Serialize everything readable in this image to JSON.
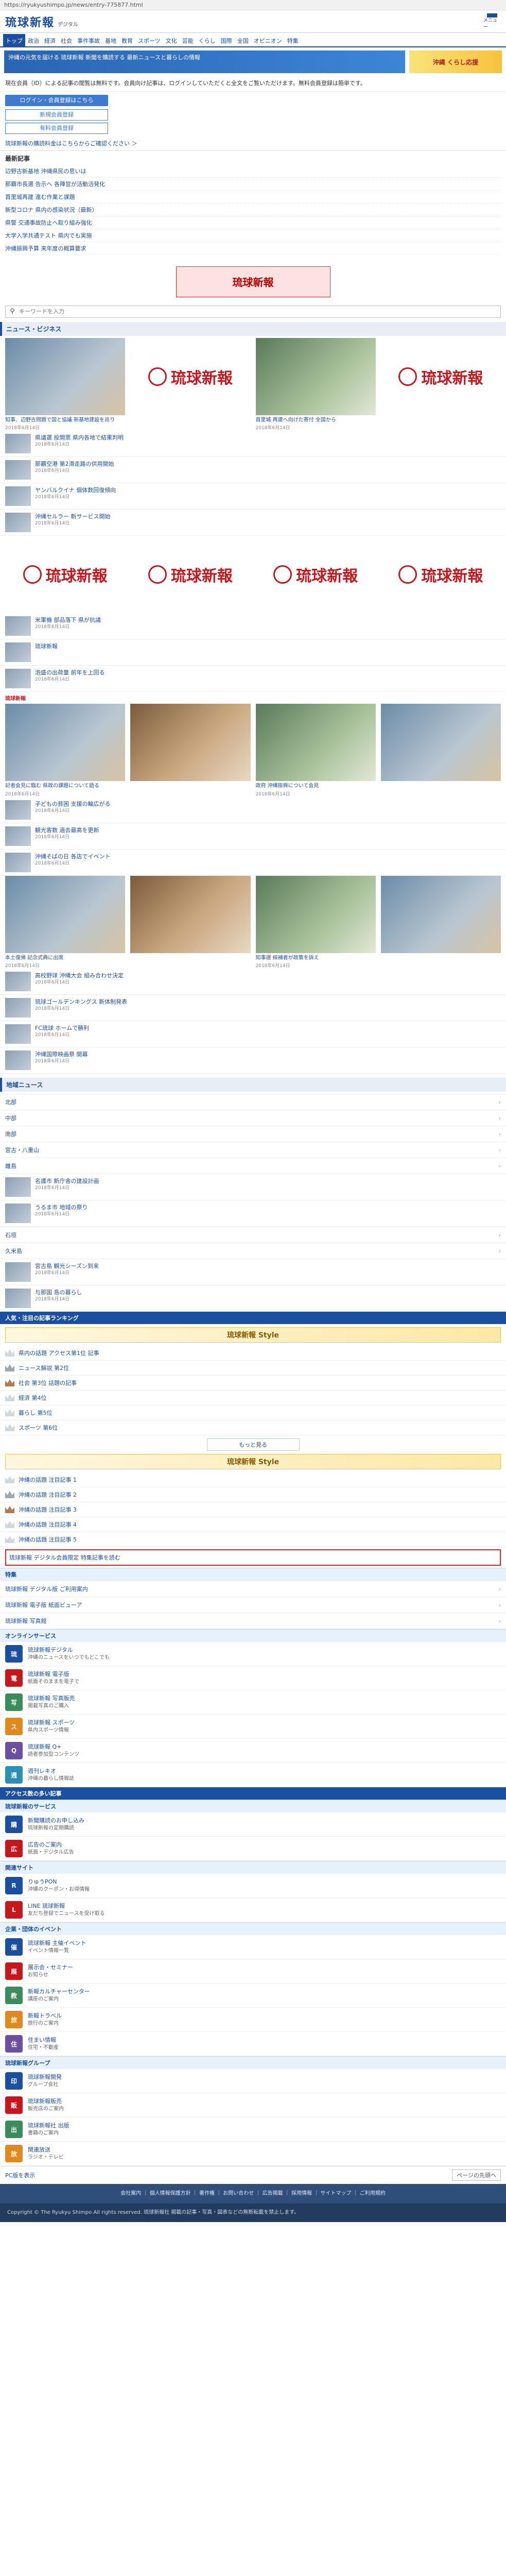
{
  "browser": {
    "url": "https://ryukyushimpo.jp/news/entry-775877.html"
  },
  "header": {
    "logo": "琉球新報",
    "logo_sub": "デジタル",
    "menu_label": "メニュー"
  },
  "gnav": [
    "トップ",
    "政治",
    "経済",
    "社会",
    "事件事故",
    "基地",
    "教育",
    "スポーツ",
    "文化",
    "芸能",
    "くらし",
    "国際",
    "全国",
    "オピニオン",
    "特集"
  ],
  "top_banner": {
    "promo_text": "沖縄の元気を届ける 琉球新報 新聞を購読する 最新ニュースと暮らしの情報",
    "ad_text": "沖縄 くらし応援"
  },
  "notice": "現在会員（ID）による記事の閲覧は無料です。会員向け記事は、ログインしていただくと全文をご覧いただけます。無料会員登録は簡単です。",
  "buttons": {
    "login": "ログイン・会員登録はこちら",
    "register": "新規会員登録",
    "paid": "有料会員登録"
  },
  "note_link": "琉球新報の購読料金はこちらからご確認ください ＞",
  "newslist": {
    "head": "最新記事",
    "items": [
      "辺野古新基地 沖縄県民の思いは",
      "那覇市長選 告示へ 各陣営が活動活発化",
      "首里城再建 進む作業と課題",
      "新型コロナ 県内の感染状況（最新）",
      "県警 交通事故防止へ取り組み強化",
      "大学入学共通テスト 県内でも実施",
      "沖縄振興予算 来年度の概算要求"
    ]
  },
  "ad_large": "琉球新報",
  "search": {
    "placeholder": "キーワードを入力"
  },
  "sec_biz": "ニュース・ビジネス",
  "cards1": [
    {
      "cap": "知事、辺野古問題で国と協議 新基地建設を巡り",
      "date": "2018年6月14日"
    },
    {
      "cap": "琉球新報",
      "date": ""
    },
    {
      "cap": "首里城 再建へ向けた寄付 全国から",
      "date": "2018年6月14日"
    },
    {
      "cap": "琉球新報",
      "date": ""
    }
  ],
  "rows1": [
    {
      "text": "県議選 投開票 県内各地で結果判明",
      "date": "2018年6月14日"
    },
    {
      "text": "那覇空港 第2滑走路の供用開始",
      "date": "2018年6月14日"
    },
    {
      "text": "ヤンバルクイナ 個体数回復傾向",
      "date": "2018年6月14日"
    },
    {
      "text": "沖縄セルラー 新サービス開始",
      "date": "2018年6月14日"
    }
  ],
  "cards2": [
    {
      "cap": "琉球新報",
      "date": ""
    },
    {
      "cap": "琉球新報",
      "date": ""
    },
    {
      "cap": "琉球新報",
      "date": ""
    },
    {
      "cap": "琉球新報",
      "date": ""
    }
  ],
  "cards2_caps": [
    "うりずんの季節 観光客でにぎわう",
    "",
    "県議会",
    ""
  ],
  "rows2": [
    {
      "text": "米軍機 部品落下 県が抗議",
      "date": "2018年6月14日"
    },
    {
      "text": "琉球新報",
      "date": ""
    },
    {
      "text": "泡盛の出荷量 前年を上回る",
      "date": "2018年6月14日"
    }
  ],
  "brand_mini": "琉球新報",
  "cards3": [
    {
      "cap": "記者会見に臨む 県政の課題について語る",
      "date": "2018年6月14日"
    },
    {
      "cap": "",
      "date": ""
    },
    {
      "cap": "政府 沖縄振興について会見",
      "date": "2018年6月14日"
    },
    {
      "cap": "",
      "date": ""
    }
  ],
  "rows3": [
    {
      "text": "子どもの貧困 支援の輪広がる",
      "date": "2018年6月14日"
    },
    {
      "text": "観光客数 過去最高を更新",
      "date": "2018年6月14日"
    },
    {
      "text": "沖縄そばの日 各店でイベント",
      "date": "2018年6月14日"
    }
  ],
  "cards4": [
    {
      "cap": "本土復帰 記念式典に出席",
      "date": "2018年6月14日"
    },
    {
      "cap": "",
      "date": ""
    },
    {
      "cap": "知事選 候補者が政策を訴え",
      "date": "2018年6月14日"
    },
    {
      "cap": "",
      "date": ""
    }
  ],
  "rows4": [
    {
      "text": "高校野球 沖縄大会 組み合わせ決定",
      "date": "2018年6月14日"
    },
    {
      "text": "琉球ゴールデンキングス 新体制発表",
      "date": "2018年6月14日"
    },
    {
      "text": "FC琉球 ホームで勝利",
      "date": "2018年6月14日"
    },
    {
      "text": "沖縄国際映画祭 開幕",
      "date": "2018年6月14日"
    }
  ],
  "sec_region": "地域ニュース",
  "region_items": [
    "北部",
    "中部",
    "南部",
    "宮古・八重山",
    "離島"
  ],
  "region_rows": [
    {
      "text": "名護市 新庁舎の建設計画",
      "date": "2018年6月14日"
    },
    {
      "text": "うるま市 地域の祭り",
      "date": "2018年6月14日"
    }
  ],
  "region_items2": [
    "石垣",
    "久米島"
  ],
  "region_rows2": [
    {
      "text": "宮古島 観光シーズン到来",
      "date": "2018年6月14日"
    },
    {
      "text": "与那国 島の暮らし",
      "date": "2018年6月14日"
    }
  ],
  "rank_title": "人気・注目の記事ランキング",
  "mid_banner": "琉球新報 Style",
  "rank_items": [
    "県内の話題 アクセス第1位 記事",
    "ニュース解説 第2位",
    "社会 第3位 話題の記事",
    "経済 第4位",
    "暮らし 第5位",
    "スポーツ 第6位"
  ],
  "more_label": "もっと見る",
  "mid_banner2": "琉球新報 Style",
  "rank_items2": [
    "沖縄の話題 注目記事 1",
    "沖縄の話題 注目記事 2",
    "沖縄の話題 注目記事 3",
    "沖縄の話題 注目記事 4",
    "沖縄の話題 注目記事 5"
  ],
  "highlight": "琉球新報 デジタル会員限定 特集記事を読む",
  "tealbar1": "特集",
  "feature_items": [
    "琉球新報 デジタル版 ご利用案内",
    "琉球新報 電子版 紙面ビューア",
    "琉球新報 写真館"
  ],
  "tealbar2": "オンラインサービス",
  "services": [
    {
      "ic": "琉",
      "title": "琉球新報デジタル",
      "sub": "沖縄のニュースをいつでもどこでも"
    },
    {
      "ic": "電",
      "title": "琉球新報 電子版",
      "sub": "紙面そのままを電子で"
    },
    {
      "ic": "写",
      "title": "琉球新報 写真販売",
      "sub": "掲載写真のご購入"
    },
    {
      "ic": "ス",
      "title": "琉球新報 スポーツ",
      "sub": "県内スポーツ情報"
    },
    {
      "ic": "Q",
      "title": "琉球新報 Q+",
      "sub": "読者参加型コンテンツ"
    },
    {
      "ic": "週",
      "title": "週刊レキオ",
      "sub": "沖縄の暮らし情報誌"
    }
  ],
  "subtitle_bar": "アクセス数の多い記事",
  "tealbar3": "琉球新報のサービス",
  "services2": [
    {
      "ic": "購",
      "title": "新聞購読のお申し込み",
      "sub": "琉球新報の定期購読"
    },
    {
      "ic": "広",
      "title": "広告のご案内",
      "sub": "紙面・デジタル広告"
    }
  ],
  "tealbar4": "関連サイト",
  "services3": [
    {
      "ic": "R",
      "title": "りゅうPON",
      "sub": "沖縄のクーポン・お得情報"
    },
    {
      "ic": "L",
      "title": "LINE 琉球新報",
      "sub": "友だち登録でニュースを受け取る"
    }
  ],
  "tealbar5": "企業・団体のイベント",
  "services4": [
    {
      "ic": "催",
      "title": "琉球新報 主催イベント",
      "sub": "イベント情報一覧"
    },
    {
      "ic": "展",
      "title": "展示会・セミナー",
      "sub": "お知らせ"
    },
    {
      "ic": "教",
      "title": "新報カルチャーセンター",
      "sub": "講座のご案内"
    },
    {
      "ic": "旅",
      "title": "新報トラベル",
      "sub": "旅行のご案内"
    },
    {
      "ic": "住",
      "title": "住まい情報",
      "sub": "住宅・不動産"
    }
  ],
  "tealbar6": "琉球新報グループ",
  "services5": [
    {
      "ic": "印",
      "title": "琉球新報開発",
      "sub": "グループ会社"
    },
    {
      "ic": "販",
      "title": "琉球新報販売",
      "sub": "販売店のご案内"
    },
    {
      "ic": "出",
      "title": "琉球新報社 出版",
      "sub": "書籍のご案内"
    },
    {
      "ic": "放",
      "title": "関連放送",
      "sub": "ラジオ・テレビ"
    }
  ],
  "footer_links": "会社案内 ｜ 個人情報保護方針 ｜ 著作権 ｜ お問い合わせ ｜ 広告掲載 ｜ 採用情報 ｜ サイトマップ ｜ ご利用規約",
  "copyright": "Copyright © The Ryukyu Shimpo All rights reserved. 琉球新報社 掲載の記事・写真・図表などの無断転載を禁止します。",
  "bottom": {
    "left": "PC版を表示",
    "pagetop": "ページの先頭へ"
  }
}
